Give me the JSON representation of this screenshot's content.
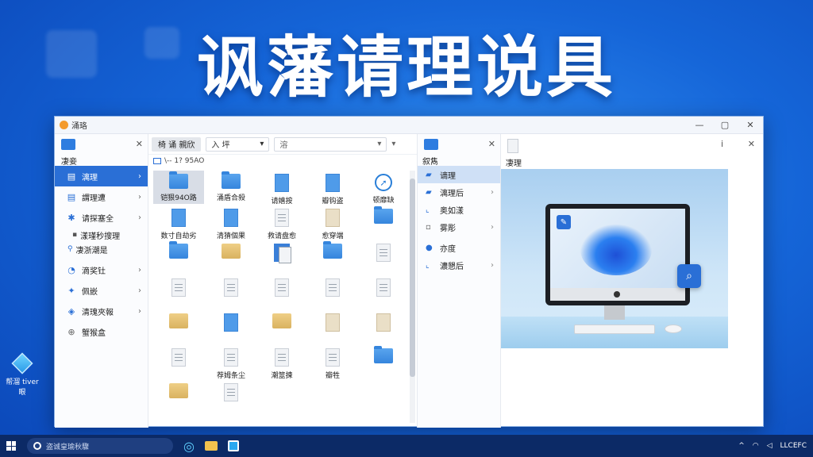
{
  "headline": "讽藩请理说具",
  "desktop_icon": {
    "label": "帮溜 tiver 眼"
  },
  "window": {
    "title": "涌珞",
    "controls": {
      "minimize": "—",
      "maximize": "▢",
      "close": "✕"
    }
  },
  "left_pane": {
    "header_label": "凄妾",
    "close": "✕",
    "items": [
      {
        "label": "漓理",
        "icon": "document-icon",
        "active": true
      },
      {
        "label": "謂理遭",
        "icon": "document-icon",
        "active": false
      },
      {
        "label": "请探塞全",
        "icon": "sparkle-icon",
        "active": false
      }
    ],
    "sub_items": [
      "漾瑾秒搜理",
      "凄浙潮是"
    ],
    "items2": [
      {
        "label": "滴奖钍",
        "icon": "clock-icon"
      },
      {
        "label": "佩嵌",
        "icon": "gear-icon"
      },
      {
        "label": "清瑰夾報",
        "icon": "shield-icon"
      },
      {
        "label": "蟹猴盒",
        "icon": "plus-icon"
      }
    ]
  },
  "toolbar": {
    "tab": "椅 诵 親欣",
    "dropdown": "入 坪",
    "search": "溶"
  },
  "address": "\\-- 1? 95AO",
  "files": [
    {
      "label": "铠狠94O路",
      "kind": "folder"
    },
    {
      "label": "涌盾合殺",
      "kind": "folder"
    },
    {
      "label": "请嬉按",
      "kind": "doc-blue"
    },
    {
      "label": "瓣钩盗",
      "kind": "doc-blue"
    },
    {
      "label": "顿靡缺",
      "kind": "compass"
    },
    {
      "label": "数寸自劫劣",
      "kind": "doc-blue"
    },
    {
      "label": "清猜個果",
      "kind": "doc-blue"
    },
    {
      "label": "救请盘愈",
      "kind": "doc"
    },
    {
      "label": "愈穿端",
      "kind": "doc-tan"
    },
    {
      "label": "",
      "kind": "folder"
    },
    {
      "label": "",
      "kind": "folder"
    },
    {
      "label": "",
      "kind": "tan-folder"
    },
    {
      "label": "",
      "kind": "dual"
    },
    {
      "label": "",
      "kind": "folder"
    },
    {
      "label": "",
      "kind": "doc"
    },
    {
      "label": "",
      "kind": "doc"
    },
    {
      "label": "",
      "kind": "doc"
    },
    {
      "label": "",
      "kind": "doc"
    },
    {
      "label": "",
      "kind": "doc"
    },
    {
      "label": "",
      "kind": "doc"
    },
    {
      "label": "",
      "kind": "tan-folder"
    },
    {
      "label": "",
      "kind": "doc-blue"
    },
    {
      "label": "",
      "kind": "tan-folder"
    },
    {
      "label": "",
      "kind": "doc-tan"
    },
    {
      "label": "",
      "kind": "doc-tan"
    },
    {
      "label": "",
      "kind": "doc"
    },
    {
      "label": "荐姆条尘",
      "kind": "doc"
    },
    {
      "label": "潮筮揀",
      "kind": "doc"
    },
    {
      "label": "瓣牲",
      "kind": "doc"
    },
    {
      "label": "",
      "kind": "folder"
    },
    {
      "label": "",
      "kind": "tan-folder"
    },
    {
      "label": "",
      "kind": "doc"
    }
  ],
  "nav2": {
    "header_label": "叙雋",
    "close": "✕",
    "items": [
      {
        "label": "谪理",
        "icon": "folder-icon",
        "active": true
      },
      {
        "label": "漓理后",
        "icon": "folder-icon",
        "active": false
      },
      {
        "label": "奥如漾",
        "icon": "chart-icon",
        "active": false
      },
      {
        "label": "雾彫",
        "icon": "box-icon",
        "active": false
      },
      {
        "label": "亦度",
        "icon": "disc-icon",
        "active": false
      },
      {
        "label": "濃懇后",
        "icon": "chart-icon",
        "active": false
      }
    ]
  },
  "preview": {
    "header_label": "凄理",
    "info": "i",
    "close": "✕"
  },
  "taskbar": {
    "search_placeholder": "盗诚皇瑜秋驟",
    "tray_text": "LLCEFC"
  }
}
